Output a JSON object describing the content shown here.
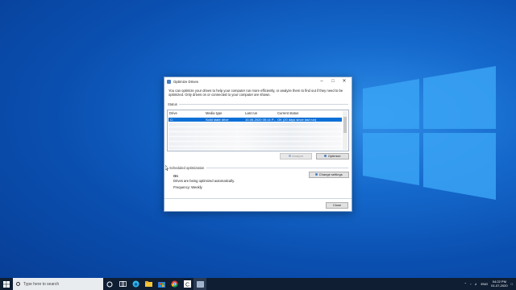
{
  "dialog": {
    "title": "Optimize Drives",
    "description": "You can optimize your drives to help your computer run more efficiently, or analyze them to find out if they need to be optimized. Only drives on or connected to your computer are shown.",
    "status_label": "Status",
    "columns": [
      "Drive",
      "Media type",
      "Last run",
      "Current status"
    ],
    "selected_row": {
      "drive": "C:",
      "media_type": "Solid state drive",
      "last_run": "10-06-2020 05:14 P...",
      "status": "OK (20 days since last run)"
    },
    "analyze_label": "Analyze",
    "optimize_label": "Optimize",
    "schedule_label": "Scheduled optimization",
    "schedule_state": "On",
    "schedule_note": "Drives are being optimized automatically.",
    "frequency": "Frequency: Weekly",
    "change_settings_label": "Change settings",
    "close_label": "Close"
  },
  "taskbar": {
    "search_placeholder": "Type here to search",
    "language": "ENG",
    "time": "04:22 PM",
    "date": "01-07-2020"
  },
  "colors": {
    "selection": "#0e70d6",
    "desktop": "#1569cc",
    "taskbar": "#0f1e33"
  }
}
